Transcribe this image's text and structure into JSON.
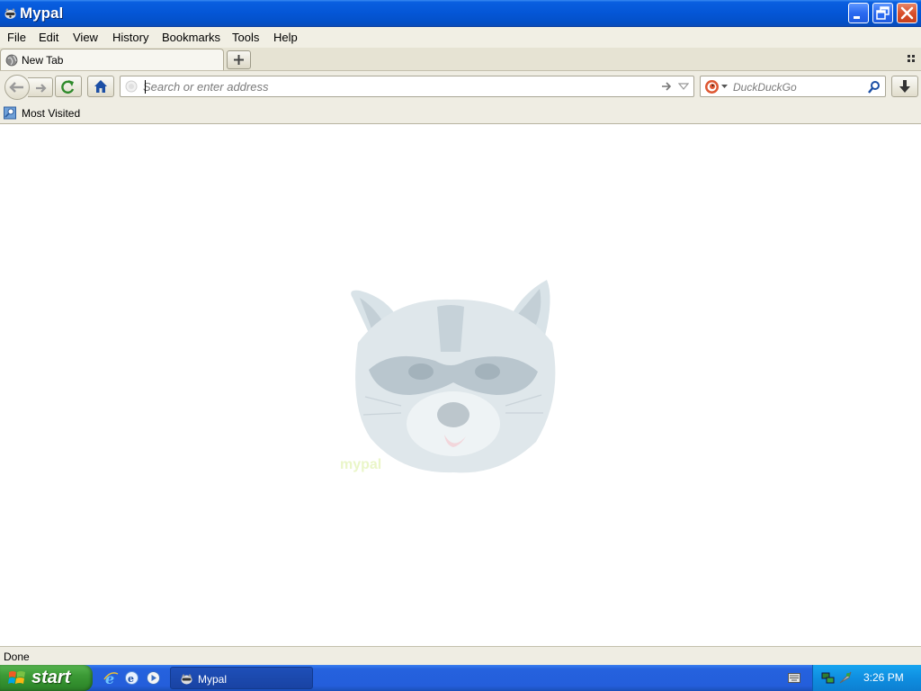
{
  "window": {
    "title": "Mypal"
  },
  "menu": {
    "items": [
      {
        "label": "File"
      },
      {
        "label": "Edit"
      },
      {
        "label": "View"
      },
      {
        "label": "History"
      },
      {
        "label": "Bookmarks"
      },
      {
        "label": "Tools"
      },
      {
        "label": "Help"
      }
    ]
  },
  "tabs": [
    {
      "label": "New Tab",
      "active": true
    }
  ],
  "toolbar": {
    "url_placeholder": "Search or enter address",
    "url_value": "",
    "search_placeholder": "DuckDuckGo",
    "search_engine": "DuckDuckGo"
  },
  "bookmarks": {
    "items": [
      {
        "label": "Most Visited",
        "icon": "folder-icon"
      }
    ]
  },
  "content": {
    "logo_icon": "raccoon-logo"
  },
  "status": {
    "text": "Done"
  },
  "taskbar": {
    "start_label": "start",
    "quick_launch": [
      "internet-explorer-icon",
      "outlook-express-icon",
      "media-player-icon"
    ],
    "tasks": [
      {
        "label": "Mypal"
      }
    ],
    "clock": "3:26 PM"
  },
  "colors": {
    "titlebar": "#0456d6",
    "taskbar": "#245edb",
    "start_button": "#3c9a36",
    "tray": "#0f8ee0",
    "chrome": "#efede3"
  }
}
